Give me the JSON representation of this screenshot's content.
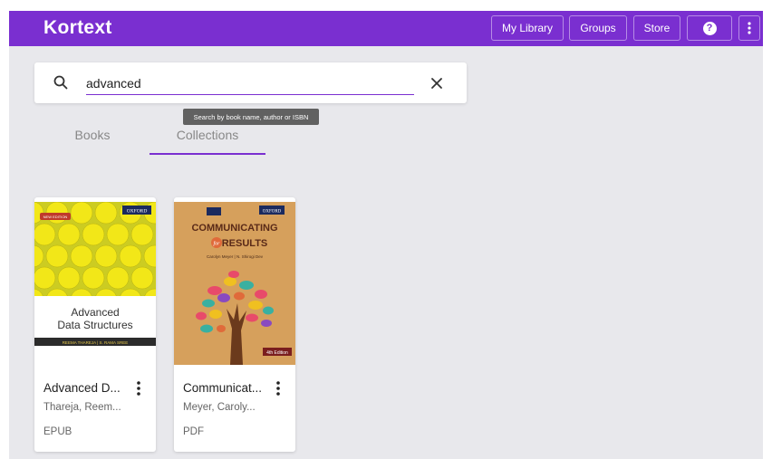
{
  "app": {
    "logo": "Kortext",
    "brand_color": "#7a2fd0"
  },
  "nav": {
    "my_library": "My Library",
    "groups": "Groups",
    "store": "Store",
    "help_icon": "help-icon",
    "more_icon": "more-vert-icon"
  },
  "search": {
    "value": "advanced",
    "placeholder": "",
    "tooltip": "Search by book name, author or ISBN"
  },
  "tabs": [
    {
      "label": "Books",
      "active": false
    },
    {
      "label": "Collections",
      "active": true
    }
  ],
  "books": [
    {
      "title": "Advanced D...",
      "author": "Thareja, Reem...",
      "format": "EPUB",
      "cover": {
        "publisher": "OXFORD",
        "badge": "NEW EDITION",
        "title_line1": "Advanced",
        "title_line2": "Data Structures",
        "authors": "REEMA THAREJA | S. RAMA SREE"
      }
    },
    {
      "title": "Communicat...",
      "author": "Meyer, Caroly...",
      "format": "PDF",
      "cover": {
        "publisher": "OXFORD",
        "title_line1": "COMMUNICATING",
        "title_for": "for",
        "title_line2": "RESULTS",
        "authors": "Carolyn Meyer | N. Shirogi Dev",
        "edition": "4th Edition"
      }
    }
  ]
}
